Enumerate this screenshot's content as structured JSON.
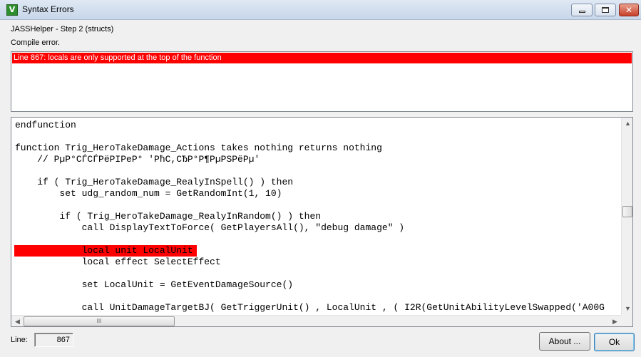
{
  "window": {
    "title": "Syntax Errors",
    "icon_letter": "V"
  },
  "window_controls": {
    "minimize_icon": "minimize-icon",
    "maximize_icon": "maximize-icon",
    "close_glyph": "✕"
  },
  "header": {
    "step": "JASSHelper - Step 2 (structs)",
    "status": "Compile error."
  },
  "errors": [
    "Line 867: locals are only supported at the top of the function"
  ],
  "editor": {
    "lines": [
      "endfunction",
      "",
      "function Trig_HeroTakeDamage_Actions takes nothing returns nothing",
      "    // PµP°CЃCЃPёPIPeP° 'PħC,CЂP°P¶PµPSPёPµ'",
      "",
      "    if ( Trig_HeroTakeDamage_RealyInSpell() ) then",
      "        set udg_random_num = GetRandomInt(1, 10)",
      "",
      "        if ( Trig_HeroTakeDamage_RealyInRandom() ) then",
      "            call DisplayTextToForce( GetPlayersAll(), \"debug damage\" )",
      "",
      "            local unit LocalUnit",
      "            local effect SelectEffect",
      "",
      "            set LocalUnit = GetEventDamageSource()",
      "",
      "            call UnitDamageTargetBJ( GetTriggerUnit() , LocalUnit , ( I2R(GetUnitAbilityLevelSwapped('A00G"
    ],
    "error_line_index": 11,
    "scrollbar_glyphs": {
      "up": "▲",
      "down": "▼",
      "left": "◀",
      "right": "▶",
      "grip": "III"
    }
  },
  "footer": {
    "line_label": "Line:",
    "line_value": "867",
    "about_label": "About ...",
    "ok_label": "Ok"
  },
  "colors": {
    "error_highlight": "#ff0000",
    "error_text": "#ffffff"
  }
}
